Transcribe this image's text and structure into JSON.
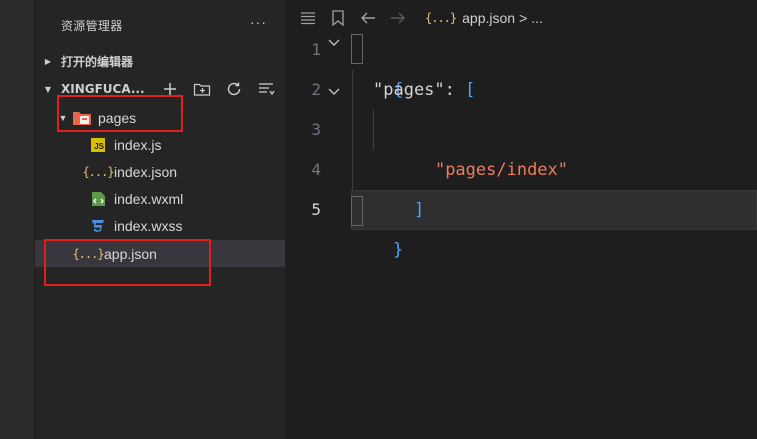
{
  "sidebar": {
    "title": "资源管理器",
    "more": "···",
    "open_editors": "打开的编辑器",
    "project": "XINGFUCA...",
    "tree": [
      {
        "label": "pages"
      },
      {
        "label": "index.js",
        "icon_text": "JS"
      },
      {
        "label": "index.json",
        "icon_text": "{...}"
      },
      {
        "label": "index.wxml"
      },
      {
        "label": "index.wxss"
      },
      {
        "label": "app.json",
        "icon_text": "{...}"
      }
    ]
  },
  "editor": {
    "breadcrumb": {
      "icon_text": "{...}",
      "file": "app.json",
      "sep": ">",
      "more": "..."
    },
    "line_numbers": [
      "1",
      "2",
      "3",
      "4",
      "5"
    ],
    "code": {
      "open_brace": "{",
      "pages_key": "\"pages\"",
      "colon": ":",
      "open_bracket": "[",
      "pages_value": "\"pages/index\"",
      "close_bracket": "]",
      "close_brace": "}"
    }
  },
  "colors": {
    "highlight_box": "#e02020",
    "string": "#f07b5c",
    "bracket": "#4fa3ff",
    "folder": "#e8674a"
  }
}
